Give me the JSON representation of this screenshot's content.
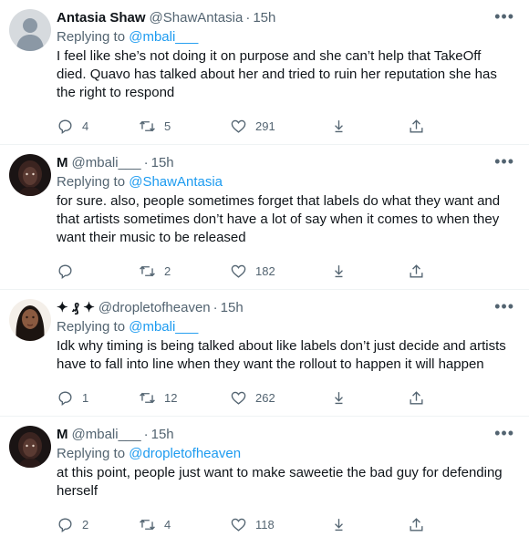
{
  "tweets": [
    {
      "name": "Antasia Shaw",
      "handle": "@ShawAntasia",
      "time": "15h",
      "dot": "·",
      "replying_prefix": "Replying to",
      "replying_to": "@mbali___",
      "text": "I feel like she’s not doing it on purpose and she can’t help that TakeOff died. Quavo has talked about her and tried to ruin her reputation she has the right to respond",
      "replies": "4",
      "retweets": "5",
      "likes": "291",
      "more": "•••"
    },
    {
      "name": "M",
      "handle": "@mbali___",
      "time": "15h",
      "dot": "·",
      "replying_prefix": "Replying to",
      "replying_to": "@ShawAntasia",
      "text": "for sure. also, people sometimes forget that labels do what they want and that artists sometimes don’t have a lot of say when it comes to when they want their music to be released",
      "replies": "",
      "retweets": "2",
      "likes": "182",
      "more": "•••"
    },
    {
      "name": "✦ ₰ ✦",
      "handle": "@dropletofheaven",
      "time": "15h",
      "dot": "·",
      "replying_prefix": "Replying to",
      "replying_to": "@mbali___",
      "text": "Idk why timing is being talked about like labels don’t just decide and artists have to fall into line when they want the rollout to happen it will happen",
      "replies": "1",
      "retweets": "12",
      "likes": "262",
      "more": "•••"
    },
    {
      "name": "M",
      "handle": "@mbali___",
      "time": "15h",
      "dot": "·",
      "replying_prefix": "Replying to",
      "replying_to": "@dropletofheaven",
      "text": "at this point, people just want to make saweetie the bad guy for defending herself",
      "replies": "2",
      "retweets": "4",
      "likes": "118",
      "more": "•••"
    }
  ],
  "colors": {
    "link": "#1d9bf0",
    "secondary": "#536471",
    "primary": "#0f1419",
    "divider": "#eff3f4"
  },
  "icons": [
    "reply-icon",
    "retweet-icon",
    "like-icon",
    "bookmark-icon",
    "share-icon",
    "more-icon"
  ]
}
